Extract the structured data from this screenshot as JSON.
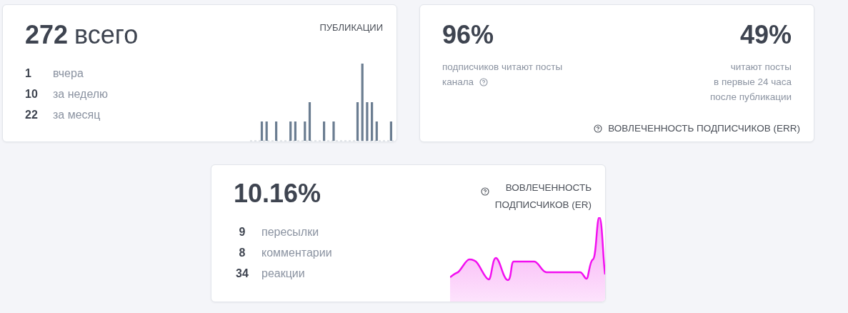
{
  "publications": {
    "total": "272",
    "total_label": "всего",
    "title": "ПУБЛИКАЦИИ",
    "stats": [
      {
        "value": "1",
        "label": "вчера"
      },
      {
        "value": "10",
        "label": "за неделю"
      },
      {
        "value": "22",
        "label": "за месяц"
      }
    ]
  },
  "err": {
    "metrics": [
      {
        "value": "96%",
        "lines": [
          "подписчиков читают посты",
          "канала"
        ],
        "help": true
      },
      {
        "value": "49%",
        "lines": [
          "читают посты",
          "в первые 24 часа",
          "после публикации"
        ],
        "help": false
      }
    ],
    "footer": "ВОВЛЕЧЕННОСТЬ ПОДПИСЧИКОВ (ERR)"
  },
  "er": {
    "value": "10.16%",
    "title_lines": [
      "ВОВЛЕЧЕННОСТЬ",
      "ПОДПИСЧИКОВ (ER)"
    ],
    "stats": [
      {
        "value": "9",
        "label": "пересылки"
      },
      {
        "value": "8",
        "label": "комментарии"
      },
      {
        "value": "34",
        "label": "реакции"
      }
    ]
  }
}
